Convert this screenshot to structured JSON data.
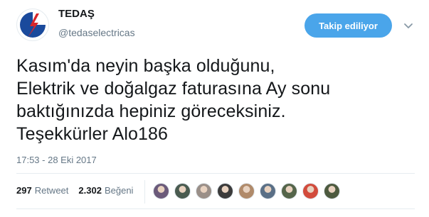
{
  "account": {
    "name": "TEDAŞ",
    "handle": "@tedaselectricas",
    "avatar_icon": "tedas-logo-icon",
    "brand_colors": {
      "blue": "#1a4a9c",
      "red": "#d7262b"
    }
  },
  "follow_button": {
    "label": "Takip ediliyor",
    "color": "#4aa5ea"
  },
  "menu": {
    "icon": "chevron-down-icon"
  },
  "tweet": {
    "lines": [
      "Kasım'da neyin başka olduğunu,",
      "Elektrik ve doğalgaz faturasına Ay sonu",
      "baktığınızda hepiniz göreceksiniz.",
      "Teşekkürler Alo186"
    ],
    "timestamp": "17:53 - 28 Eki 2017"
  },
  "stats": {
    "retweets_count": "297",
    "retweets_label": "Retweet",
    "likes_count": "2.302",
    "likes_label": "Beğeni"
  },
  "likers": [
    {
      "icon": "liker-avatar-icon",
      "color": "#6b5a7a"
    },
    {
      "icon": "liker-avatar-icon",
      "color": "#4a5b50"
    },
    {
      "icon": "liker-avatar-icon",
      "color": "#9a8f88"
    },
    {
      "icon": "liker-avatar-icon",
      "color": "#3b3b3b"
    },
    {
      "icon": "liker-avatar-icon",
      "color": "#b08a6a"
    },
    {
      "icon": "liker-avatar-icon",
      "color": "#5a6f86"
    },
    {
      "icon": "liker-avatar-icon",
      "color": "#55654a"
    },
    {
      "icon": "liker-avatar-icon",
      "color": "#d24b3c"
    },
    {
      "icon": "liker-avatar-icon",
      "color": "#4d5a3f"
    }
  ]
}
